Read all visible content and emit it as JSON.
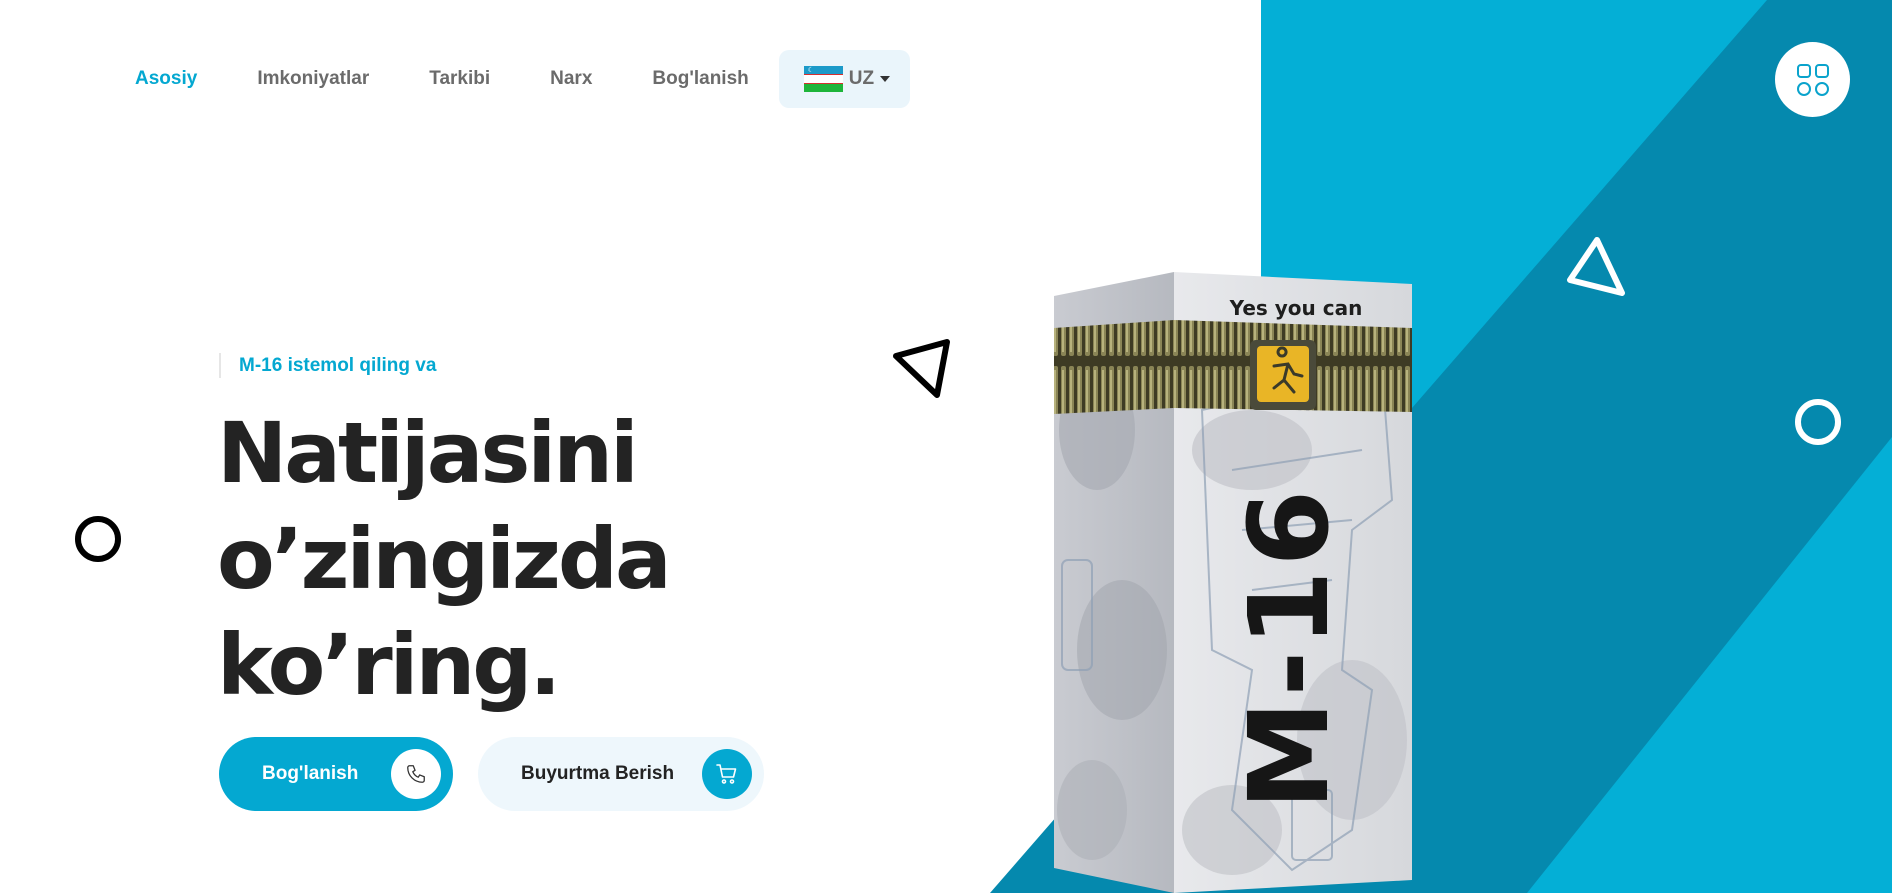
{
  "nav": {
    "items": [
      {
        "label": "Asosiy",
        "active": true
      },
      {
        "label": "Imkoniyatlar",
        "active": false
      },
      {
        "label": "Tarkibi",
        "active": false
      },
      {
        "label": "Narx",
        "active": false
      },
      {
        "label": "Bog'lanish",
        "active": false
      }
    ],
    "language": {
      "code": "UZ",
      "flag": "uzbekistan-flag"
    }
  },
  "menu": {
    "icon": "grid-icon"
  },
  "hero": {
    "eyebrow": "M-16 istemol qiling va",
    "headline_lines": [
      "Natijasini",
      "o’zingizda",
      "ko’ring."
    ],
    "primary_button": {
      "label": "Bog'lanish",
      "icon": "phone-icon"
    },
    "secondary_button": {
      "label": "Buyurtma Berish",
      "icon": "cart-icon"
    }
  },
  "product": {
    "tagline": "Yes you can",
    "name": "M-16"
  },
  "colors": {
    "accent": "#04a8d1",
    "accent_dark": "#0588ad",
    "heading": "#232323",
    "nav_text": "#6b6b6b"
  }
}
